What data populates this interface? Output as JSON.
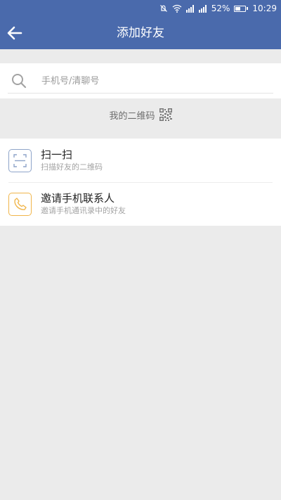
{
  "status_bar": {
    "icons": [
      "mute-icon",
      "wifi-icon",
      "signal-icon",
      "signal-icon"
    ],
    "battery_text": "52%",
    "battery_level": 0.52,
    "time": "10:29"
  },
  "app_bar": {
    "title": "添加好友",
    "back_icon": "arrow-left-icon",
    "background": "#4a6aac"
  },
  "search": {
    "placeholder": "手机号/清聊号",
    "value": "",
    "icon": "search-icon"
  },
  "qr": {
    "label": "我的二维码",
    "icon": "qr-code-icon"
  },
  "options": [
    {
      "title": "扫一扫",
      "subtitle": "扫描好友的二维码",
      "icon": "scan-icon",
      "icon_color": "#8ea4c9"
    },
    {
      "title": "邀请手机联系人",
      "subtitle": "邀请手机通讯录中的好友",
      "icon": "phone-icon",
      "icon_color": "#f0b54a"
    }
  ]
}
